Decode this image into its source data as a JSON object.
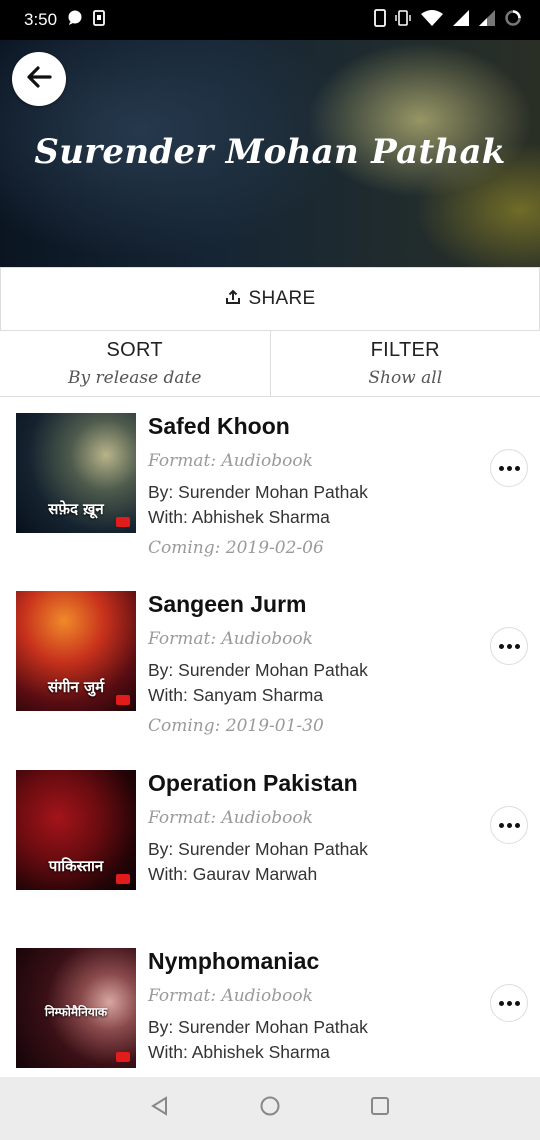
{
  "status_bar": {
    "time": "3:50"
  },
  "header": {
    "title": "Surender Mohan Pathak"
  },
  "share": {
    "label": "SHARE"
  },
  "sort": {
    "label": "SORT",
    "value": "By release date"
  },
  "filter": {
    "label": "FILTER",
    "value": "Show all"
  },
  "books": [
    {
      "title": "Safed Khoon",
      "format": "Format: Audiobook",
      "by": "By: Surender Mohan Pathak",
      "with": "With: Abhishek Sharma",
      "coming": "Coming: 2019-02-06",
      "cover_text": "सफ़ेद ख़ून"
    },
    {
      "title": "Sangeen Jurm",
      "format": "Format: Audiobook",
      "by": "By: Surender Mohan Pathak",
      "with": "With: Sanyam Sharma",
      "coming": "Coming: 2019-01-30",
      "cover_text": "संगीन जुर्म"
    },
    {
      "title": "Operation Pakistan",
      "format": "Format: Audiobook",
      "by": "By: Surender Mohan Pathak",
      "with": "With: Gaurav Marwah",
      "coming": "",
      "cover_text": "पाकिस्तान"
    },
    {
      "title": "Nymphomaniac",
      "format": "Format: Audiobook",
      "by": "By: Surender Mohan Pathak",
      "with": "With: Abhishek Sharma",
      "coming": "",
      "cover_text": "निम्फोमैनियाक"
    }
  ],
  "icons": {
    "back": "arrow-left-icon",
    "share": "share-upload-icon",
    "more": "more-horizontal-icon",
    "nav_back": "triangle-back-icon",
    "nav_home": "circle-home-icon",
    "nav_recents": "square-recents-icon"
  },
  "colors": {
    "status_bar": "#000000",
    "nav_bar": "#ececec",
    "meta_text": "#9a9a9a"
  }
}
